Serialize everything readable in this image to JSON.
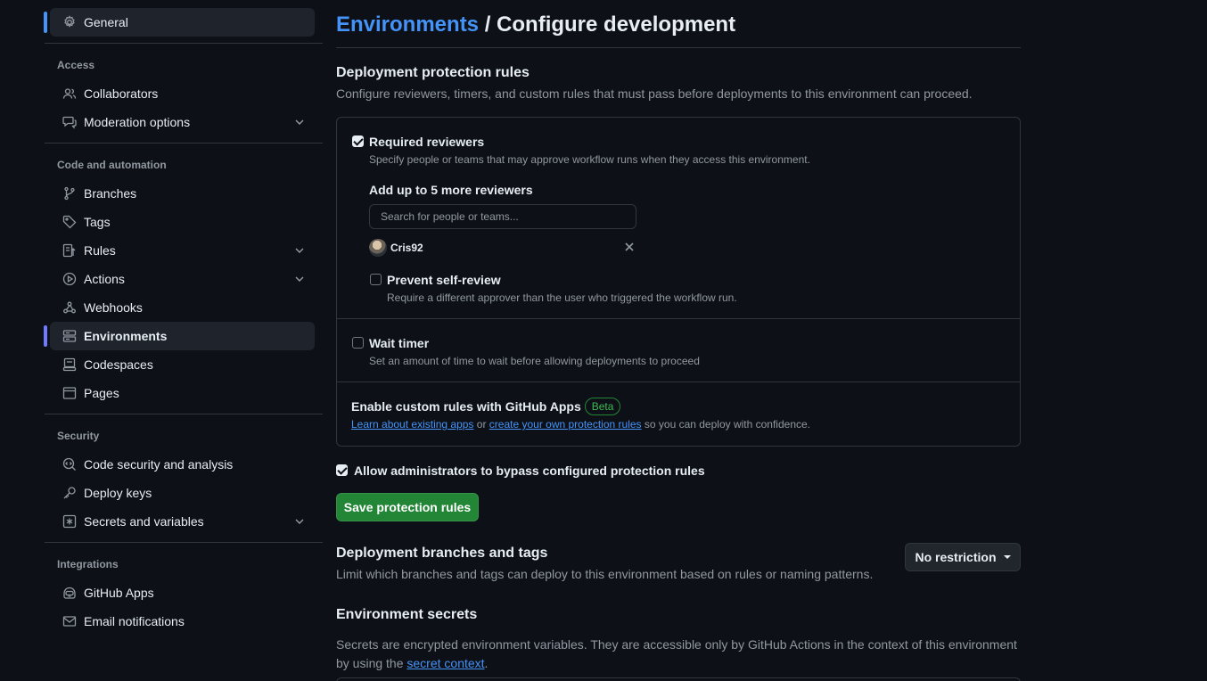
{
  "sidebar": {
    "general": "General",
    "access_heading": "Access",
    "collaborators": "Collaborators",
    "moderation": "Moderation options",
    "code_heading": "Code and automation",
    "branches": "Branches",
    "tags": "Tags",
    "rules": "Rules",
    "actions": "Actions",
    "webhooks": "Webhooks",
    "environments": "Environments",
    "codespaces": "Codespaces",
    "pages": "Pages",
    "security_heading": "Security",
    "code_security": "Code security and analysis",
    "deploy_keys": "Deploy keys",
    "secrets": "Secrets and variables",
    "integrations_heading": "Integrations",
    "github_apps": "GitHub Apps",
    "email_notifications": "Email notifications"
  },
  "header": {
    "breadcrumb": "Environments",
    "separator": " / ",
    "title": "Configure development"
  },
  "protection": {
    "title": "Deployment protection rules",
    "description": "Configure reviewers, timers, and custom rules that must pass before deployments to this environment can proceed.",
    "required_reviewers_label": "Required reviewers",
    "required_reviewers_checked": true,
    "required_reviewers_desc": "Specify people or teams that may approve workflow runs when they access this environment.",
    "add_reviewers_label": "Add up to 5 more reviewers",
    "search_placeholder": "Search for people or teams...",
    "reviewer_name": "Cris92",
    "prevent_self_review_label": "Prevent self-review",
    "prevent_self_review_checked": false,
    "prevent_self_review_desc": "Require a different approver than the user who triggered the workflow run.",
    "wait_timer_label": "Wait timer",
    "wait_timer_checked": false,
    "wait_timer_desc": "Set an amount of time to wait before allowing deployments to proceed",
    "custom_rules_title": "Enable custom rules with GitHub Apps",
    "beta_badge": "Beta",
    "learn_link": "Learn about existing apps",
    "or_text": " or ",
    "create_link": "create your own protection rules",
    "confidence_text": " so you can deploy with confidence.",
    "allow_admin_label": "Allow administrators to bypass configured protection rules",
    "allow_admin_checked": true,
    "save_button": "Save protection rules"
  },
  "branches": {
    "title": "Deployment branches and tags",
    "description": "Limit which branches and tags can deploy to this environment based on rules or naming patterns.",
    "dropdown_value": "No restriction"
  },
  "secrets": {
    "title": "Environment secrets",
    "description_line1": "Secrets are encrypted environment variables. They are accessible only by GitHub Actions in the context of this environment",
    "description_prefix": "by using the ",
    "context_link": "secret context",
    "description_suffix": "."
  },
  "colors": {
    "background": "#0d1117",
    "accent_link": "#4493f8",
    "green_button": "#238636",
    "active_indicator": "#6e7bff"
  }
}
